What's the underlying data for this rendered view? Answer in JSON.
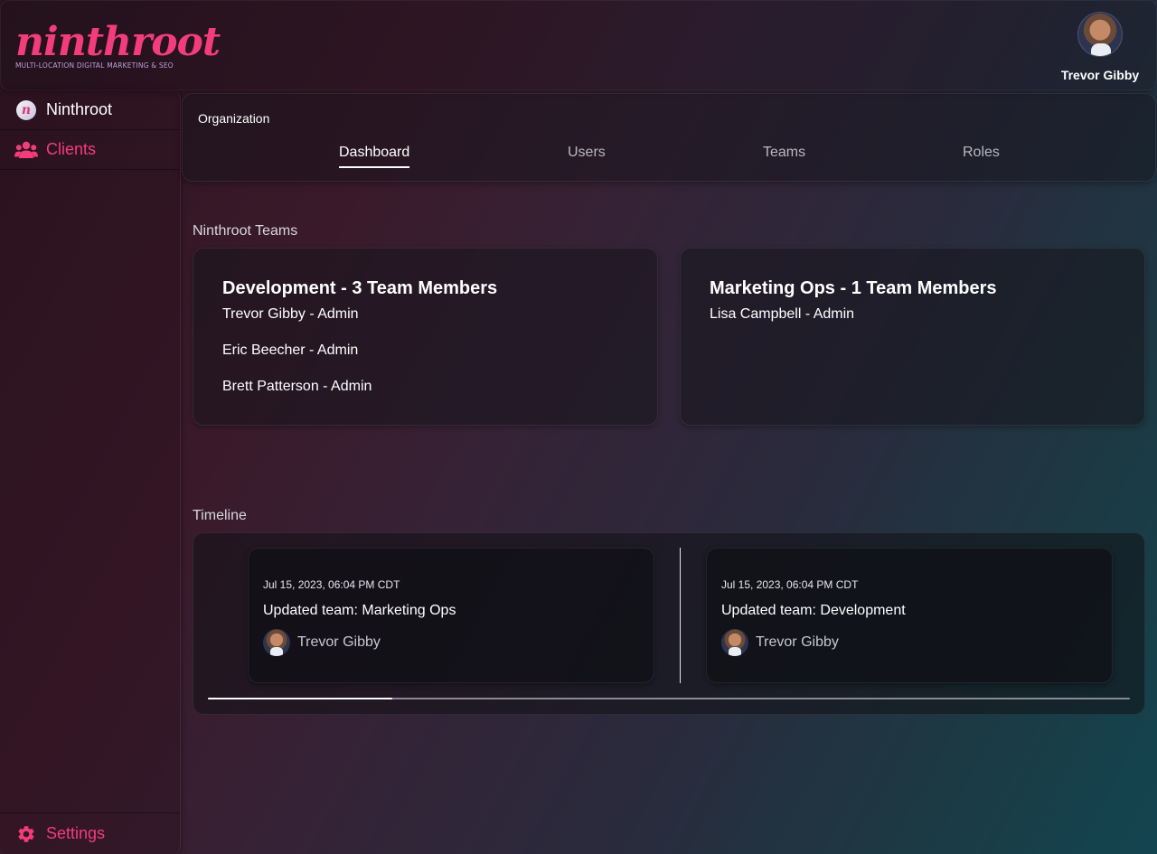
{
  "brand": {
    "logo_text": "ninthroot",
    "tagline": "MULTI-LOCATION DIGITAL MARKETING & SEO",
    "accent_color": "#f23d7a"
  },
  "user": {
    "name": "Trevor Gibby"
  },
  "sidebar": {
    "items": [
      {
        "label": "Ninthroot",
        "icon": "n-logo-icon"
      },
      {
        "label": "Clients",
        "icon": "users-icon"
      }
    ],
    "settings_label": "Settings",
    "settings_icon": "gear-icon"
  },
  "org": {
    "label": "Organization",
    "tabs": [
      {
        "label": "Dashboard",
        "active": true
      },
      {
        "label": "Users",
        "active": false
      },
      {
        "label": "Teams",
        "active": false
      },
      {
        "label": "Roles",
        "active": false
      }
    ]
  },
  "teams_section": {
    "title": "Ninthroot Teams",
    "teams": [
      {
        "title": "Development - 3 Team Members",
        "members": [
          "Trevor Gibby - Admin",
          "Eric Beecher - Admin",
          "Brett Patterson - Admin"
        ]
      },
      {
        "title": "Marketing Ops - 1 Team Members",
        "members": [
          "Lisa Campbell - Admin"
        ]
      }
    ]
  },
  "timeline": {
    "title": "Timeline",
    "scroll_fraction": 0.2,
    "events": [
      {
        "date": "Jul 15, 2023, 06:04 PM CDT",
        "text": "Updated team: Marketing Ops",
        "user": "Trevor Gibby"
      },
      {
        "date": "Jul 15, 2023, 06:04 PM CDT",
        "text": "Updated team: Development",
        "user": "Trevor Gibby"
      }
    ]
  }
}
